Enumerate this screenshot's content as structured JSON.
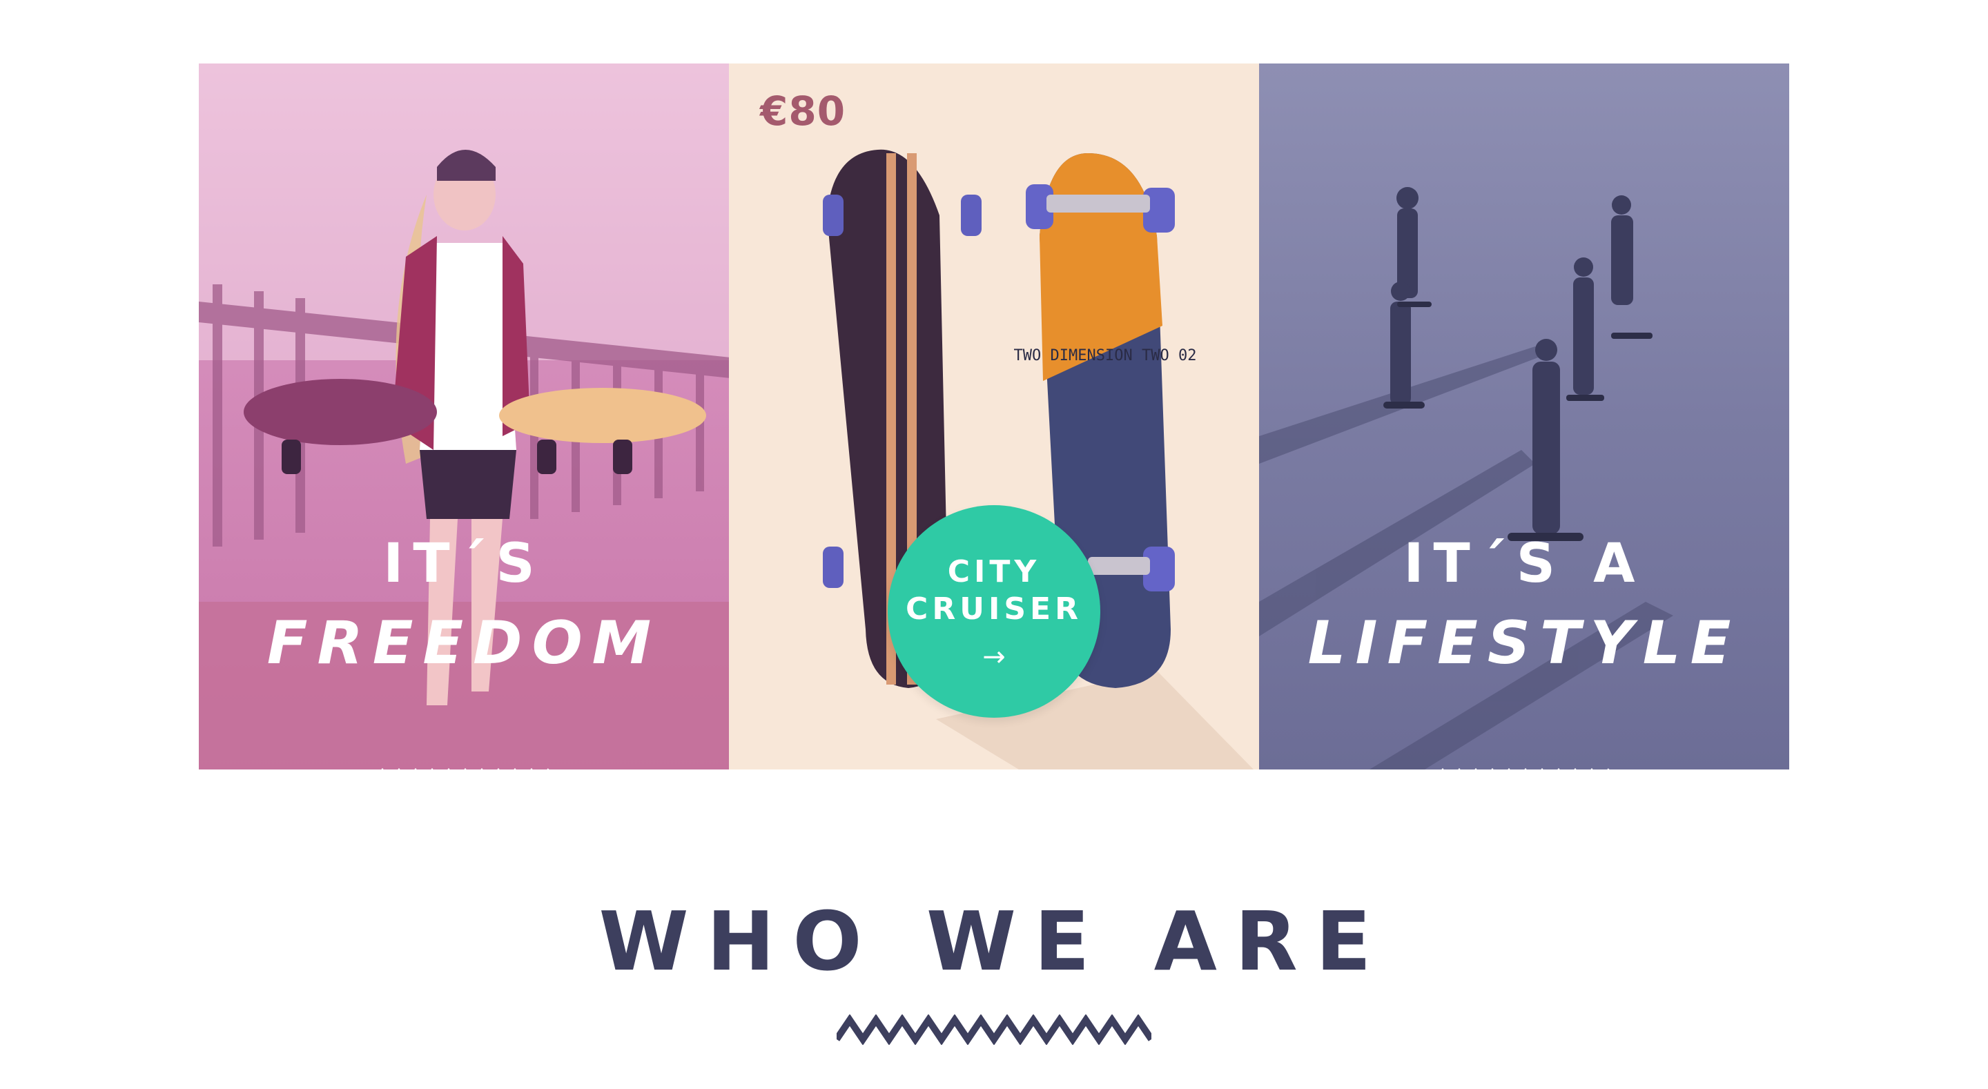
{
  "panels": {
    "freedom": {
      "line1": "IT´S",
      "line2": "FREEDOM",
      "tint": "#d58dbb"
    },
    "product": {
      "price": "€80",
      "cta_line1": "CITY",
      "cta_line2": "CRUISER",
      "cta_arrow": "→",
      "cta_color": "#2fcaa5",
      "board_print": "TWO DIMENSION TWO 02"
    },
    "lifestyle": {
      "line1": "IT´S A",
      "line2": "LIFESTYLE",
      "tint": "#7b7ca3"
    }
  },
  "section": {
    "title": "WHO WE ARE",
    "color": "#3d3f5e"
  },
  "icons": {
    "divider": "zigzag-divider-icon",
    "arrow": "arrow-right-icon"
  }
}
